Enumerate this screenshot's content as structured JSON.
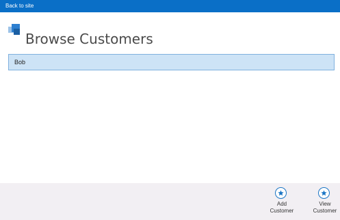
{
  "topbar": {
    "back_label": "Back to site",
    "color": "#0a6fc7"
  },
  "header": {
    "title": "Browse Customers",
    "logo_icon": "app-logo-icon"
  },
  "customers": [
    {
      "name": "Bob"
    }
  ],
  "appbar": {
    "buttons": [
      {
        "label": "Add Customer",
        "icon": "star-icon"
      },
      {
        "label": "View Customer",
        "icon": "star-icon"
      }
    ]
  },
  "colors": {
    "accent": "#1a74c4",
    "selection_bg": "#cde3f6",
    "selection_border": "#7fb0de",
    "appbar_bg": "#f2eff3"
  }
}
